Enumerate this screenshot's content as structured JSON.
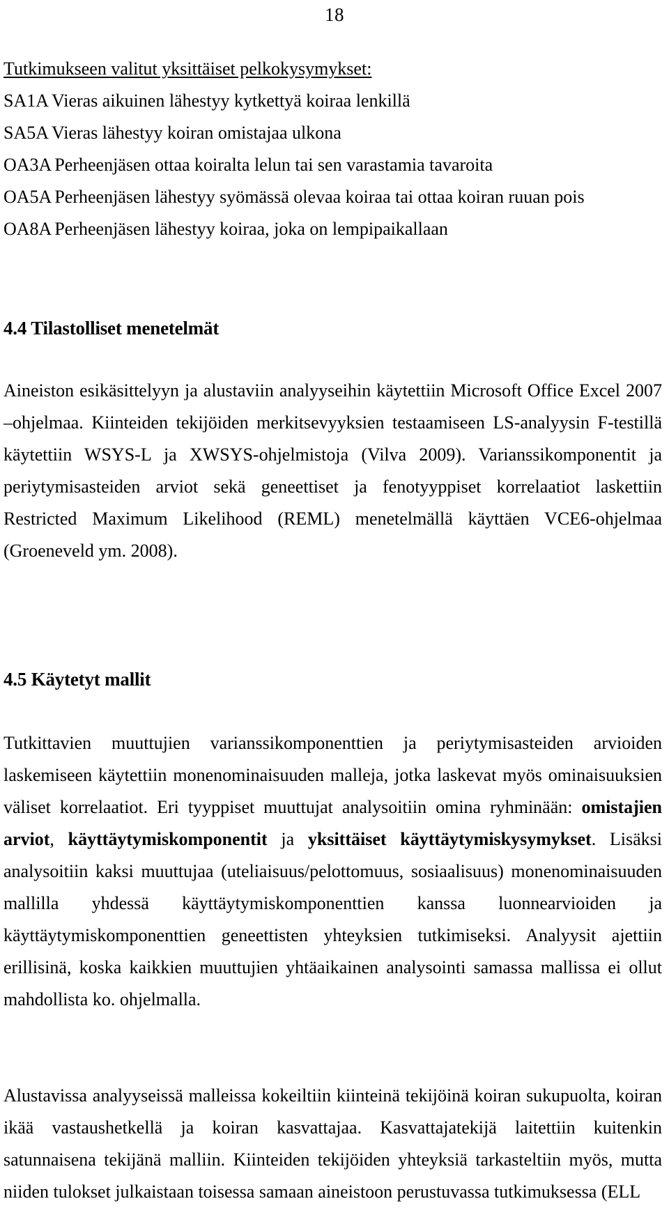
{
  "page": {
    "number": "18"
  },
  "questions_block": {
    "heading": "Tutkimukseen valitut yksittäiset pelkokysymykset:",
    "items": [
      {
        "code": "SA1A",
        "text": "Vieras aikuinen lähestyy kytkettyä koiraa lenkillä"
      },
      {
        "code": "SA5A",
        "text": "Vieras lähestyy koiran omistajaa ulkona"
      },
      {
        "code": "OA3A",
        "text": "Perheenjäsen ottaa koiralta lelun tai sen varastamia tavaroita"
      },
      {
        "code": "OA5A",
        "text": "Perheenjäsen lähestyy syömässä olevaa koiraa tai ottaa koiran ruuan pois"
      },
      {
        "code": "OA8A",
        "text": "Perheenjäsen lähestyy koiraa, joka on lempipaikallaan"
      }
    ]
  },
  "section_44": {
    "heading": "4.4 Tilastolliset menetelmät",
    "paragraph": "Aineiston esikäsittelyyn ja alustaviin analyyseihin käytettiin Microsoft Office Excel 2007 –ohjelmaa. Kiinteiden tekijöiden merkitsevyyksien testaamiseen LS-analyysin F-testillä käytettiin WSYS-L ja XWSYS-ohjelmistoja (Vilva 2009). Varianssikomponentit ja periytymisasteiden arviot sekä geneettiset ja fenotyyppiset korrelaatiot laskettiin Restricted Maximum Likelihood (REML) menetelmällä käyttäen VCE6-ohjelmaa (Groeneveld ym. 2008)."
  },
  "section_45": {
    "heading": "4.5 Käytetyt mallit",
    "paragraph1_part1": "Tutkittavien muuttujien varianssikomponenttien ja periytymisasteiden arvioiden laskemiseen käytettiin monenominaisuuden malleja, jotka laskevat myös ominaisuuksien väliset korrelaatiot. Eri tyyppiset muuttujat analysoitiin omina ryhminään: ",
    "bold1": "omistajien arviot",
    "paragraph1_mid1": ", ",
    "bold2": "käyttäytymiskomponentit",
    "paragraph1_mid2": " ja ",
    "bold3": "yksittäiset käyttäytymiskysymykset",
    "paragraph1_part2": ". Lisäksi analysoitiin kaksi muuttujaa (uteliaisuus/pelottomuus, sosiaalisuus) monenominaisuuden mallilla yhdessä käyttäytymiskomponenttien kanssa luonnearvioiden ja käyttäytymiskomponenttien geneettisten yhteyksien tutkimiseksi. Analyysit ajettiin erillisinä, koska kaikkien muuttujien yhtäaikainen analysointi samassa mallissa ei ollut mahdollista ko. ohjelmalla.",
    "paragraph2": "Alustavissa analyyseissä malleissa kokeiltiin kiinteinä tekijöinä koiran sukupuolta, koiran ikää vastaushetkellä ja koiran kasvattajaa. Kasvattajatekijä laitettiin kuitenkin satunnaisena tekijänä malliin. Kiinteiden tekijöiden yhteyksiä tarkasteltiin myös, mutta niiden tulokset julkaistaan toisessa samaan aineistoon perustuvassa tutkimuksessa (ELL"
  }
}
